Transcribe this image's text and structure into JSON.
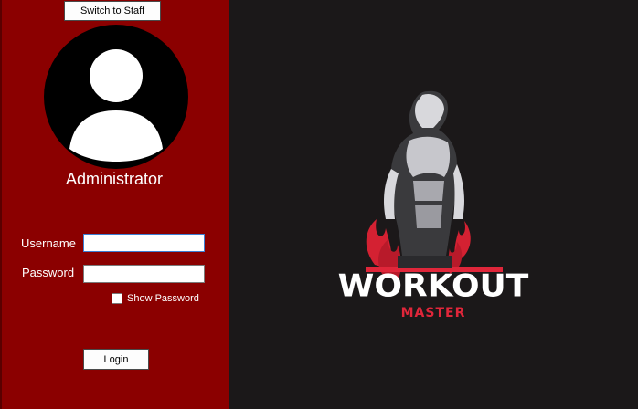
{
  "header": {
    "switch_label": "Switch to Staff"
  },
  "profile": {
    "role": "Administrator",
    "avatar_icon": "user-avatar-icon"
  },
  "form": {
    "username_label": "Username",
    "username_value": "",
    "password_label": "Password",
    "password_value": "",
    "show_password_label": "Show Password",
    "show_password_checked": false,
    "login_label": "Login"
  },
  "brand": {
    "name": "WORKOUT",
    "tagline": "MASTER",
    "accent_color": "#e0263a",
    "panel_color": "#8b0000",
    "background_color": "#1b1819"
  }
}
